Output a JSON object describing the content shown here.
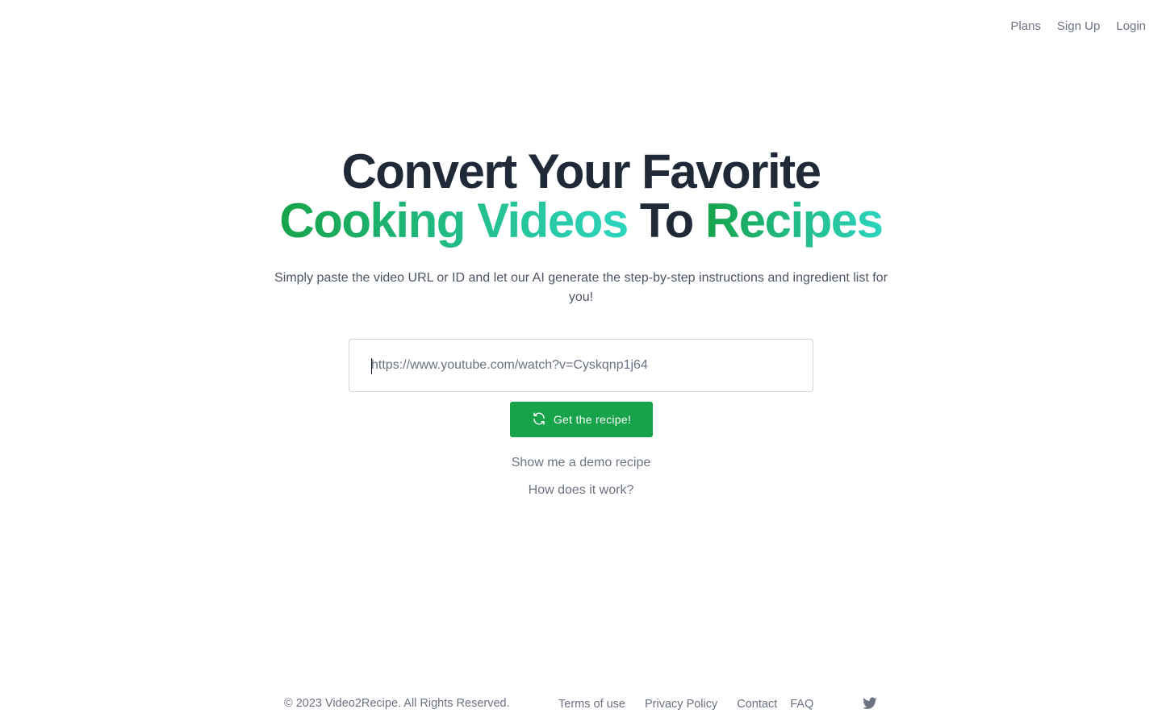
{
  "nav": {
    "items": [
      {
        "label": "Plans"
      },
      {
        "label": "Sign Up"
      },
      {
        "label": "Login"
      }
    ]
  },
  "hero": {
    "line1": "Convert Your Favorite",
    "line2": {
      "part1": "Cooking Videos",
      "part2": "To",
      "part3": "Recipes"
    },
    "subtitle": "Simply paste the video URL or ID and let our AI generate the step-by-step instructions and ingredient list for you!"
  },
  "form": {
    "url_placeholder": "https://www.youtube.com/watch?v=Cyskqnp1j64",
    "url_value": "",
    "submit_label": "Get the recipe!",
    "submit_icon": "refresh-icon"
  },
  "links": {
    "demo": "Show me a demo recipe",
    "how": "How does it work?"
  },
  "footer": {
    "copyright": "© 2023 Video2Recipe. All Rights Reserved.",
    "links": [
      {
        "label": "Terms of use"
      },
      {
        "label": "Privacy Policy"
      },
      {
        "label": "Contact"
      },
      {
        "label": "FAQ"
      }
    ],
    "social_icon": "twitter-icon"
  },
  "colors": {
    "accent": "#16a34a",
    "gradient_end": "#2dd4bf",
    "heading": "#1f2937",
    "muted": "#6b7280"
  }
}
